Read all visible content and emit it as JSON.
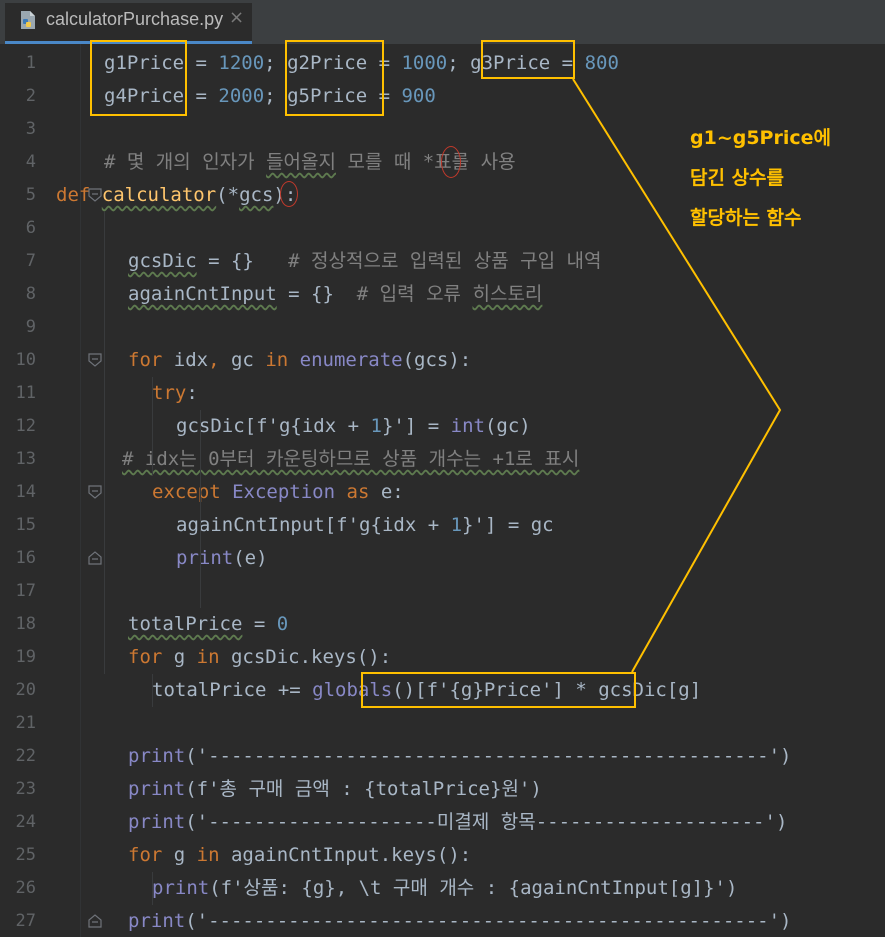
{
  "tab": {
    "file_name": "calculatorPurchase.py",
    "close_glyph": "×"
  },
  "annotation": {
    "lines": [
      "g1~g5Price에",
      "담긴 상수를",
      "할당하는 함수"
    ],
    "color": "#ffc000"
  },
  "lines": [
    {
      "n": "1",
      "indent": 4,
      "segs": [
        [
          "g1Price",
          ""
        ],
        [
          " = ",
          ""
        ],
        [
          "1200",
          "num"
        ],
        [
          ";",
          ""
        ],
        [
          " ",
          ""
        ],
        [
          "g2Price",
          ""
        ],
        [
          " = ",
          ""
        ],
        [
          "1000",
          "num"
        ],
        [
          ";",
          ""
        ],
        [
          " ",
          ""
        ],
        [
          "g3Price",
          ""
        ],
        [
          " = ",
          ""
        ],
        [
          "800",
          "num"
        ]
      ]
    },
    {
      "n": "2",
      "indent": 4,
      "segs": [
        [
          "g4Price",
          ""
        ],
        [
          " = ",
          ""
        ],
        [
          "2000",
          "num"
        ],
        [
          ";",
          ""
        ],
        [
          " ",
          ""
        ],
        [
          "g5Price",
          ""
        ],
        [
          " = ",
          ""
        ],
        [
          "900",
          "num"
        ]
      ]
    },
    {
      "n": "3",
      "indent": 0,
      "segs": []
    },
    {
      "n": "4",
      "indent": 4,
      "segs": [
        [
          "# 몇 개의 인자가 ",
          "cm"
        ],
        [
          "들어올지",
          "cm squig"
        ],
        [
          " 모를 때 *표를 사용",
          "cm"
        ]
      ]
    },
    {
      "n": "5",
      "indent": 0,
      "segs": [
        [
          "def",
          "kw"
        ],
        [
          " ",
          ""
        ],
        [
          "calculator",
          "fn squig"
        ],
        [
          "(*",
          ""
        ],
        [
          "gcs",
          "squig"
        ],
        [
          "):",
          ""
        ]
      ]
    },
    {
      "n": "6",
      "indent": 0,
      "segs": []
    },
    {
      "n": "7",
      "indent": 6,
      "segs": [
        [
          "gcsDic",
          "squig"
        ],
        [
          " = {}   ",
          ""
        ],
        [
          "# 정상적으로 입력된 상품 구입 내역",
          "cm"
        ]
      ]
    },
    {
      "n": "8",
      "indent": 6,
      "segs": [
        [
          "againCntInput",
          "squig"
        ],
        [
          " = {}  ",
          ""
        ],
        [
          "# 입력 오류 ",
          "cm"
        ],
        [
          "히스토리",
          "cm squig"
        ]
      ]
    },
    {
      "n": "9",
      "indent": 0,
      "segs": []
    },
    {
      "n": "10",
      "indent": 6,
      "segs": [
        [
          "for",
          "kw"
        ],
        [
          " idx",
          ""
        ],
        [
          ",",
          "kw"
        ],
        [
          " gc ",
          ""
        ],
        [
          "in",
          "kw"
        ],
        [
          " ",
          ""
        ],
        [
          "enumerate",
          "bi"
        ],
        [
          "(gcs):",
          ""
        ]
      ]
    },
    {
      "n": "11",
      "indent": 8,
      "segs": [
        [
          "try",
          "kw"
        ],
        [
          ":",
          ""
        ]
      ]
    },
    {
      "n": "12",
      "indent": 10,
      "segs": [
        [
          "gcsDic[",
          ""
        ],
        [
          "f'g",
          ""
        ],
        [
          "{",
          ""
        ],
        [
          "idx + ",
          ""
        ],
        [
          "1",
          "num"
        ],
        [
          "}",
          ""
        ],
        [
          "'",
          ""
        ],
        [
          "] = ",
          ""
        ],
        [
          "int",
          "bi"
        ],
        [
          "(gc)",
          ""
        ]
      ]
    },
    {
      "n": "13",
      "indent": 5.5,
      "segs": [
        [
          "# idx는 0부터 카운팅하므로 상품 개수는 +1로 표시",
          "cm squig"
        ]
      ]
    },
    {
      "n": "14",
      "indent": 8,
      "segs": [
        [
          "except",
          "kw"
        ],
        [
          " ",
          ""
        ],
        [
          "Exception",
          "bi"
        ],
        [
          " ",
          ""
        ],
        [
          "as",
          "kw"
        ],
        [
          " e:",
          ""
        ]
      ]
    },
    {
      "n": "15",
      "indent": 10,
      "segs": [
        [
          "againCntInput[",
          ""
        ],
        [
          "f'g",
          ""
        ],
        [
          "{",
          ""
        ],
        [
          "idx + ",
          ""
        ],
        [
          "1",
          "num"
        ],
        [
          "}",
          ""
        ],
        [
          "'",
          ""
        ],
        [
          "] = gc",
          ""
        ]
      ]
    },
    {
      "n": "16",
      "indent": 10,
      "segs": [
        [
          "print",
          "bi"
        ],
        [
          "(e)",
          ""
        ]
      ]
    },
    {
      "n": "17",
      "indent": 0,
      "segs": []
    },
    {
      "n": "18",
      "indent": 6,
      "segs": [
        [
          "totalPrice",
          "squig"
        ],
        [
          " = ",
          ""
        ],
        [
          "0",
          "num"
        ]
      ]
    },
    {
      "n": "19",
      "indent": 6,
      "segs": [
        [
          "for",
          "kw"
        ],
        [
          " g ",
          ""
        ],
        [
          "in",
          "kw"
        ],
        [
          " gcsDic.keys():",
          ""
        ]
      ]
    },
    {
      "n": "20",
      "indent": 8,
      "segs": [
        [
          "totalPrice += ",
          ""
        ],
        [
          "globals",
          "bi"
        ],
        [
          "()[",
          ""
        ],
        [
          "f'",
          ""
        ],
        [
          "{",
          ""
        ],
        [
          "g",
          ""
        ],
        [
          "}",
          ""
        ],
        [
          "Price'",
          ""
        ],
        [
          "] * gcsDic[g]",
          ""
        ]
      ]
    },
    {
      "n": "21",
      "indent": 0,
      "segs": []
    },
    {
      "n": "22",
      "indent": 6,
      "segs": [
        [
          "print",
          "bi"
        ],
        [
          "(",
          ""
        ],
        [
          "'-------------------------------------------------'",
          ""
        ],
        [
          ")",
          ""
        ]
      ]
    },
    {
      "n": "23",
      "indent": 6,
      "segs": [
        [
          "print",
          "bi"
        ],
        [
          "(",
          ""
        ],
        [
          "f'총 구매 금액 : ",
          ""
        ],
        [
          "{",
          ""
        ],
        [
          "totalPrice",
          ""
        ],
        [
          "}",
          ""
        ],
        [
          "원'",
          ""
        ],
        [
          ")",
          ""
        ]
      ]
    },
    {
      "n": "24",
      "indent": 6,
      "segs": [
        [
          "print",
          "bi"
        ],
        [
          "(",
          ""
        ],
        [
          "'--------------------미결제 항목--------------------'",
          ""
        ],
        [
          ")",
          ""
        ]
      ]
    },
    {
      "n": "25",
      "indent": 6,
      "segs": [
        [
          "for",
          "kw"
        ],
        [
          " g ",
          ""
        ],
        [
          "in",
          "kw"
        ],
        [
          " againCntInput.keys():",
          ""
        ]
      ]
    },
    {
      "n": "26",
      "indent": 8,
      "segs": [
        [
          "print",
          "bi"
        ],
        [
          "(",
          ""
        ],
        [
          "f'상품: ",
          ""
        ],
        [
          "{",
          ""
        ],
        [
          "g",
          ""
        ],
        [
          "}",
          ""
        ],
        [
          ", \\t 구매 개수 : ",
          ""
        ],
        [
          "{",
          ""
        ],
        [
          "againCntInput[g]",
          ""
        ],
        [
          "}",
          ""
        ],
        [
          "'",
          ""
        ],
        [
          ")",
          ""
        ]
      ]
    },
    {
      "n": "27",
      "indent": 6,
      "segs": [
        [
          "print",
          "bi"
        ],
        [
          "(",
          ""
        ],
        [
          "'-------------------------------------------------'",
          ""
        ],
        [
          ")",
          ""
        ]
      ]
    }
  ]
}
